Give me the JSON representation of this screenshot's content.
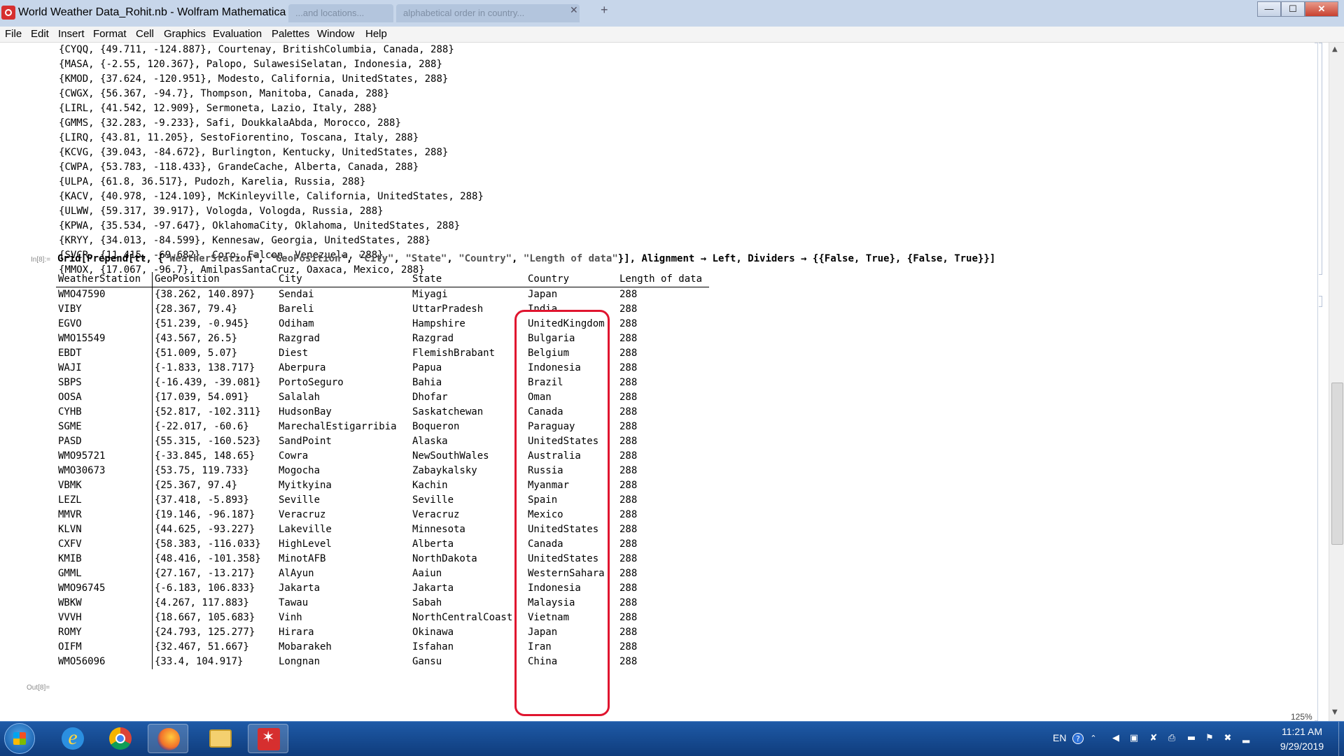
{
  "window": {
    "title": "World Weather Data_Rohit.nb - Wolfram Mathematica 11.1",
    "background_tabs": [
      "...and locations...",
      "alphabetical order in country..."
    ],
    "controls": {
      "minimize": "—",
      "maximize": "☐",
      "close": "✕"
    }
  },
  "menu": [
    "File",
    "Edit",
    "Insert",
    "Format",
    "Cell",
    "Graphics",
    "Evaluation",
    "Palettes",
    "Window",
    "Help"
  ],
  "previous_output": [
    {
      "code": "CYQQ",
      "geo": "{49.711, -124.887}",
      "rest": "Courtenay, BritishColumbia, Canada, 288"
    },
    {
      "code": "MASA",
      "geo": "{-2.55, 120.367}",
      "rest": "Palopo, SulawesiSelatan, Indonesia, 288"
    },
    {
      "code": "KMOD",
      "geo": "{37.624, -120.951}",
      "rest": "Modesto, California, UnitedStates, 288"
    },
    {
      "code": "CWGX",
      "geo": "{56.367, -94.7}",
      "rest": "Thompson, Manitoba, Canada, 288"
    },
    {
      "code": "LIRL",
      "geo": "{41.542, 12.909}",
      "rest": "Sermoneta, Lazio, Italy, 288"
    },
    {
      "code": "GMMS",
      "geo": "{32.283, -9.233}",
      "rest": "Safi, DoukkalaAbda, Morocco, 288"
    },
    {
      "code": "LIRQ",
      "geo": "{43.81, 11.205}",
      "rest": "SestoFiorentino, Toscana, Italy, 288"
    },
    {
      "code": "KCVG",
      "geo": "{39.043, -84.672}",
      "rest": "Burlington, Kentucky, UnitedStates, 288"
    },
    {
      "code": "CWPA",
      "geo": "{53.783, -118.433}",
      "rest": "GrandeCache, Alberta, Canada, 288"
    },
    {
      "code": "ULPA",
      "geo": "{61.8, 36.517}",
      "rest": "Pudozh, Karelia, Russia, 288"
    },
    {
      "code": "KACV",
      "geo": "{40.978, -124.109}",
      "rest": "McKinleyville, California, UnitedStates, 288"
    },
    {
      "code": "ULWW",
      "geo": "{59.317, 39.917}",
      "rest": "Vologda, Vologda, Russia, 288"
    },
    {
      "code": "KPWA",
      "geo": "{35.534, -97.647}",
      "rest": "OklahomaCity, Oklahoma, UnitedStates, 288"
    },
    {
      "code": "KRYY",
      "geo": "{34.013, -84.599}",
      "rest": "Kennesaw, Georgia, UnitedStates, 288"
    },
    {
      "code": "SVCR",
      "geo": "{11.415, -69.682}",
      "rest": "Coro, Falcon, Venezuela, 288"
    },
    {
      "code": "MMOX",
      "geo": "{17.067, -96.7}",
      "rest": "AmilpasSantaCruz, Oaxaca, Mexico, 288"
    }
  ],
  "input": {
    "label": "In[8]:=",
    "head": "Grid[Prepend[tt, {",
    "s1": "\"WeatherStation\"",
    "s2": "\"GeoPosition\"",
    "s3": "\"City\"",
    "s4": "\"State\"",
    "s5": "\"Country\"",
    "s6": "\"Length of data\"",
    "tail": "}], Alignment → Left, Dividers → {{False, True}, {False, True}}]",
    "sep": ", "
  },
  "output_label": "Out[8]=",
  "grid": {
    "headers": [
      "WeatherStation",
      "GeoPosition",
      "City",
      "State",
      "Country",
      "Length of data"
    ],
    "rows": [
      [
        "WMO47590",
        "{38.262, 140.897}",
        "Sendai",
        "Miyagi",
        "Japan",
        "288"
      ],
      [
        "VIBY",
        "{28.367, 79.4}",
        "Bareli",
        "UttarPradesh",
        "India",
        "288"
      ],
      [
        "EGVO",
        "{51.239, -0.945}",
        "Odiham",
        "Hampshire",
        "UnitedKingdom",
        "288"
      ],
      [
        "WMO15549",
        "{43.567, 26.5}",
        "Razgrad",
        "Razgrad",
        "Bulgaria",
        "288"
      ],
      [
        "EBDT",
        "{51.009, 5.07}",
        "Diest",
        "FlemishBrabant",
        "Belgium",
        "288"
      ],
      [
        "WAJI",
        "{-1.833, 138.717}",
        "Aberpura",
        "Papua",
        "Indonesia",
        "288"
      ],
      [
        "SBPS",
        "{-16.439, -39.081}",
        "PortoSeguro",
        "Bahia",
        "Brazil",
        "288"
      ],
      [
        "OOSA",
        "{17.039, 54.091}",
        "Salalah",
        "Dhofar",
        "Oman",
        "288"
      ],
      [
        "CYHB",
        "{52.817, -102.311}",
        "HudsonBay",
        "Saskatchewan",
        "Canada",
        "288"
      ],
      [
        "SGME",
        "{-22.017, -60.6}",
        "MarechalEstigarribia",
        "Boqueron",
        "Paraguay",
        "288"
      ],
      [
        "PASD",
        "{55.315, -160.523}",
        "SandPoint",
        "Alaska",
        "UnitedStates",
        "288"
      ],
      [
        "WMO95721",
        "{-33.845, 148.65}",
        "Cowra",
        "NewSouthWales",
        "Australia",
        "288"
      ],
      [
        "WMO30673",
        "{53.75, 119.733}",
        "Mogocha",
        "Zabaykalsky",
        "Russia",
        "288"
      ],
      [
        "VBMK",
        "{25.367, 97.4}",
        "Myitkyina",
        "Kachin",
        "Myanmar",
        "288"
      ],
      [
        "LEZL",
        "{37.418, -5.893}",
        "Seville",
        "Seville",
        "Spain",
        "288"
      ],
      [
        "MMVR",
        "{19.146, -96.187}",
        "Veracruz",
        "Veracruz",
        "Mexico",
        "288"
      ],
      [
        "KLVN",
        "{44.625, -93.227}",
        "Lakeville",
        "Minnesota",
        "UnitedStates",
        "288"
      ],
      [
        "CXFV",
        "{58.383, -116.033}",
        "HighLevel",
        "Alberta",
        "Canada",
        "288"
      ],
      [
        "KMIB",
        "{48.416, -101.358}",
        "MinotAFB",
        "NorthDakota",
        "UnitedStates",
        "288"
      ],
      [
        "GMML",
        "{27.167, -13.217}",
        "AlAyun",
        "Aaiun",
        "WesternSahara",
        "288"
      ],
      [
        "WMO96745",
        "{-6.183, 106.833}",
        "Jakarta",
        "Jakarta",
        "Indonesia",
        "288"
      ],
      [
        "WBKW",
        "{4.267, 117.883}",
        "Tawau",
        "Sabah",
        "Malaysia",
        "288"
      ],
      [
        "VVVH",
        "{18.667, 105.683}",
        "Vinh",
        "NorthCentralCoast",
        "Vietnam",
        "288"
      ],
      [
        "ROMY",
        "{24.793, 125.277}",
        "Hirara",
        "Okinawa",
        "Japan",
        "288"
      ],
      [
        "OIFM",
        "{32.467, 51.667}",
        "Mobarakeh",
        "Isfahan",
        "Iran",
        "288"
      ],
      [
        "WMO56096",
        "{33.4, 104.917}",
        "Longnan",
        "Gansu",
        "China",
        "288"
      ]
    ]
  },
  "highlight_color": "#e0152f",
  "zoom": "125%",
  "taskbar": {
    "language": "EN",
    "time": "11:21 AM",
    "date": "9/29/2019",
    "apps": [
      "internet-explorer-icon",
      "chrome-icon",
      "firefox-icon",
      "file-explorer-icon",
      "mathematica-icon"
    ]
  }
}
